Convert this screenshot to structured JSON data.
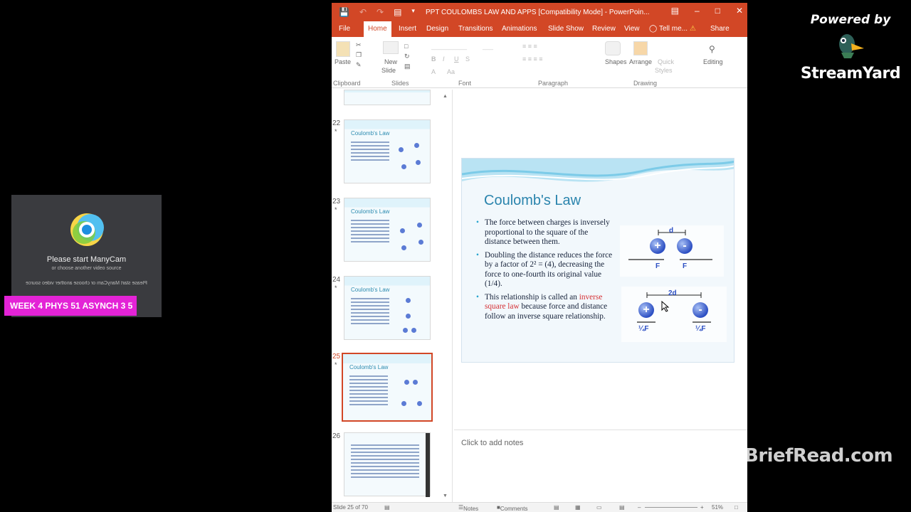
{
  "overlay": {
    "powered_by": "Powered by",
    "brand": "StreamYard",
    "manycam_title": "Please start ManyCam",
    "manycam_sub": "or choose another video source",
    "manycam_sub2": "Please start ManyCam or choose another video source",
    "week_tag": "WEEK 4 PHYS 51 ASYNCH 3 5",
    "watermark": "BriefRead.com"
  },
  "window": {
    "title": "PPT COULOMBS LAW AND APPS [Compatibility Mode] - PowerPoin...",
    "tabs": [
      "File",
      "Home",
      "Insert",
      "Design",
      "Transitions",
      "Animations",
      "Slide Show",
      "Review",
      "View",
      "Tell me...",
      "Share"
    ],
    "active_tab": "Home"
  },
  "ribbon": {
    "paste": "Paste",
    "new_slide": "New",
    "new_slide2": "Slide",
    "shapes": "Shapes",
    "arrange": "Arrange",
    "quick_styles": "Quick",
    "quick_styles2": "Styles",
    "editing": "Editing",
    "groups": [
      "Clipboard",
      "Slides",
      "Font",
      "Paragraph",
      "Drawing"
    ]
  },
  "thumbnails": [
    {
      "number": "22",
      "title": "Coulomb's Law"
    },
    {
      "number": "23",
      "title": "Coulomb's Law"
    },
    {
      "number": "24",
      "title": "Coulomb's Law"
    },
    {
      "number": "25",
      "title": "Coulomb's Law"
    },
    {
      "number": "26",
      "title": ""
    }
  ],
  "slide": {
    "title": "Coulomb's Law",
    "bullet1": "The force between charges is inversely proportional to the square of the distance between them.",
    "bullet2": "Doubling the distance reduces the force by a factor of 2² = (4), decreasing the force to one-fourth its original value (1/4).",
    "bullet3_pre": "This relationship is called an ",
    "bullet3_red": "inverse square law",
    "bullet3_post": " because force and distance follow an inverse square relationship.",
    "diagram1": {
      "distance": "d",
      "force_left": "F",
      "force_right": "F",
      "plus": "+",
      "minus": "-"
    },
    "diagram2": {
      "distance": "2d",
      "force_left": "¼F",
      "force_right": "¼F",
      "plus": "+",
      "minus": "-"
    }
  },
  "notes_placeholder": "Click to add notes",
  "status": {
    "slide_count": "Slide 25 of 70",
    "notes": "Notes",
    "comments": "Comments",
    "zoom": "51%"
  },
  "colors": {
    "accent": "#d24726",
    "week_tag": "#e323d6",
    "slide_title": "#2a84ad"
  }
}
